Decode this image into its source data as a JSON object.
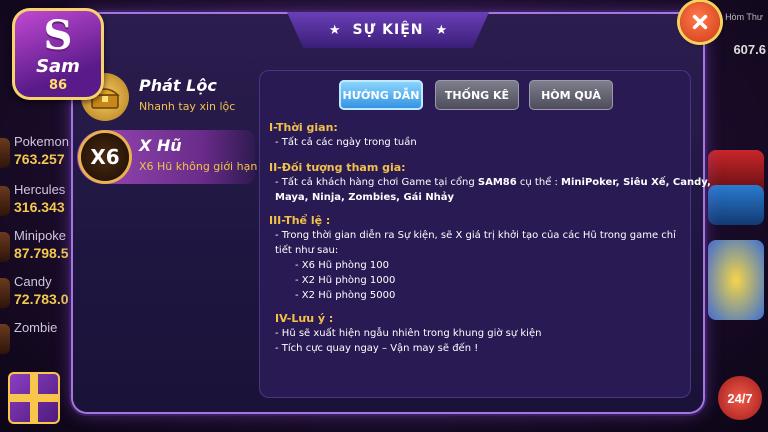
{
  "modal": {
    "title": "SỰ KIỆN",
    "close_icon": "close-icon"
  },
  "background": {
    "jackpots": [
      {
        "name": "Pokemon",
        "value": "763.257"
      },
      {
        "name": "Hercules",
        "value": "316.343"
      },
      {
        "name": "Minipoke",
        "value": "87.798.5"
      },
      {
        "name": "Candy",
        "value": "72.783.0"
      },
      {
        "name": "Zombie",
        "value": ""
      }
    ],
    "inbox_label": "Hòm Thư",
    "right_value": "607.6",
    "support_label": "24/7"
  },
  "logo": {
    "letter": "S",
    "name": "Sam",
    "number": "86"
  },
  "events": [
    {
      "title": "Phát Lộc",
      "subtitle": "Nhanh tay xin lộc",
      "icon": "treasure-chest-icon",
      "active": false
    },
    {
      "title": "X Hũ",
      "subtitle": "X6 Hũ không giới hạn",
      "icon_text": "X6",
      "active": true
    }
  ],
  "tabs": [
    {
      "label": "HƯỚNG DẪN",
      "active": true
    },
    {
      "label": "THỐNG KÊ",
      "active": false
    },
    {
      "label": "HÒM QUÀ",
      "active": false
    }
  ],
  "guide": {
    "s1_title": "I-Thời gian:",
    "s1_l1": "Tất cả các ngày trong tuần",
    "s2_title": "II-Đối tượng tham gia:",
    "s2_l1a": "Tất cả khách hàng chơi Game tại cổng ",
    "s2_l1b": "SAM86",
    "s2_l1c": " cụ thể : ",
    "s2_l1d": "MiniPoker, Siêu Xế, Candy,",
    "s2_l2": "Maya, Ninja, Zombies, Gái Nhảy",
    "s3_title": "III-Thể lệ :",
    "s3_l1": "Trong thời gian diễn ra Sự kiện, sẽ X giá trị khởi tạo của các Hũ trong game chỉ",
    "s3_l2": "tiết như sau:",
    "s3_items": [
      "X6 Hũ phòng 100",
      "X2 Hũ phòng 1000",
      "X2 Hũ phòng 5000"
    ],
    "s4_title": "IV-Lưu ý :",
    "s4_l1": "Hũ sẽ xuất hiện ngẫu nhiên trong khung giờ sự kiện",
    "s4_l2": "Tích cực quay ngay – Vận may sẽ đến !"
  }
}
